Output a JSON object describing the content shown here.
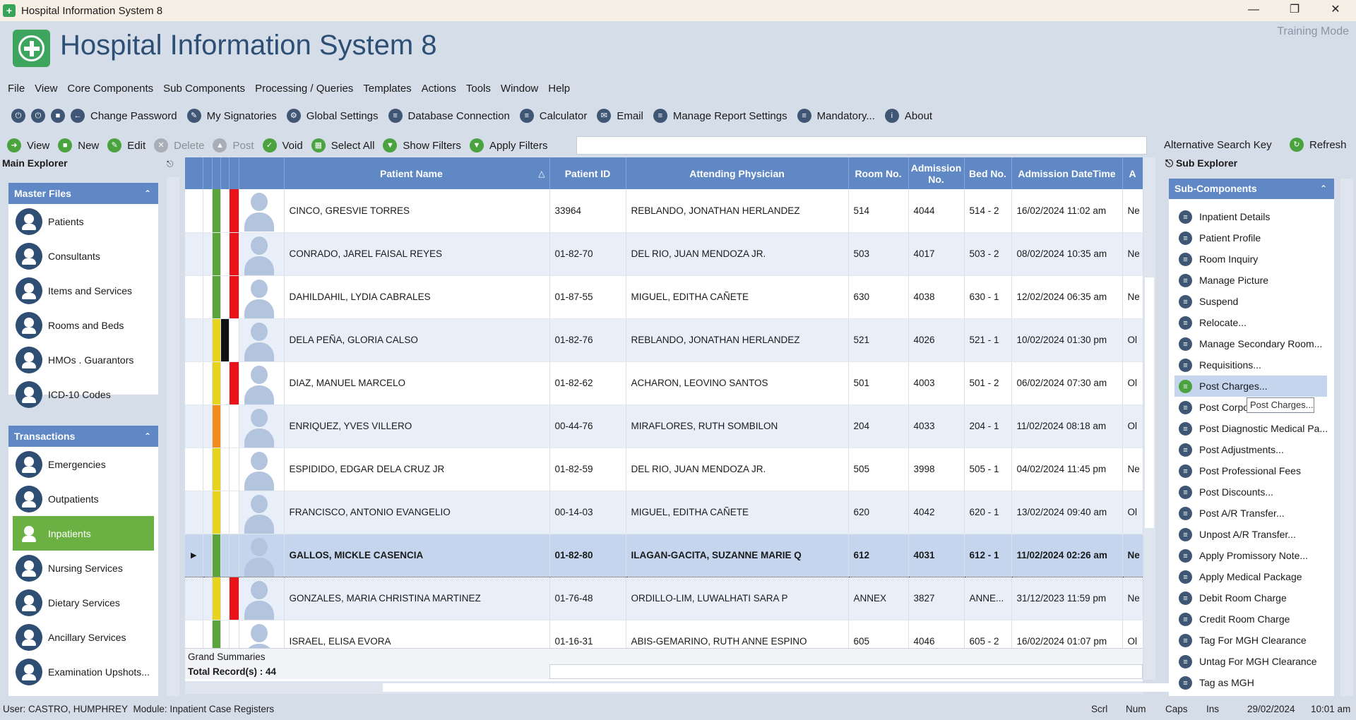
{
  "window": {
    "title": "Hospital Information System 8"
  },
  "banner": {
    "title": "Hospital Information System 8",
    "mode": "Training Mode"
  },
  "menu": [
    "File",
    "View",
    "Core Components",
    "Sub Components",
    "Processing / Queries",
    "Templates",
    "Actions",
    "Tools",
    "Window",
    "Help"
  ],
  "toolbar1": [
    "Change Password",
    "My Signatories",
    "Global Settings",
    "Database Connection",
    "Calculator",
    "Email",
    "Manage Report Settings",
    "Mandatory...",
    "About"
  ],
  "toolbar2": {
    "view": "View",
    "new": "New",
    "edit": "Edit",
    "delete": "Delete",
    "post": "Post",
    "void": "Void",
    "select_all": "Select All",
    "show_filters": "Show Filters",
    "apply_filters": "Apply Filters",
    "search_value": "",
    "alt_search": "Alternative Search Key",
    "refresh": "Refresh"
  },
  "left": {
    "header": "Main Explorer",
    "master_title": "Master Files",
    "master_items": [
      "Patients",
      "Consultants",
      "Items and Services",
      "Rooms and Beds",
      "HMOs . Guarantors",
      "ICD-10 Codes"
    ],
    "trans_title": "Transactions",
    "trans_items": [
      "Emergencies",
      "Outpatients",
      "Inpatients",
      "Nursing Services",
      "Dietary Services",
      "Ancillary Services",
      "Examination Upshots..."
    ]
  },
  "grid": {
    "columns": [
      "Patient Name",
      "Patient ID",
      "Attending Physician",
      "Room No.",
      "Admission No.",
      "Bed No.",
      "Admission DateTime",
      "A"
    ],
    "rows": [
      {
        "name": "CINCO, GRESVIE TORRES",
        "id": "33964",
        "phys": "REBLANDO, JONATHAN HERLANDEZ",
        "room": "514",
        "adm": "4044",
        "bed": "514 - 2",
        "dt": "16/02/2024 11:02 am",
        "x": "Ne",
        "c1": "#5aa43b",
        "c2": "#ffffff",
        "c3": "#e8141a"
      },
      {
        "name": "CONRADO, JAREL FAISAL REYES",
        "id": "01-82-70",
        "phys": "DEL RIO, JUAN MENDOZA JR.",
        "room": "503",
        "adm": "4017",
        "bed": "503 - 2",
        "dt": "08/02/2024 10:35 am",
        "x": "Ne",
        "c1": "#5aa43b",
        "c2": "#ffffff",
        "c3": "#e8141a"
      },
      {
        "name": "DAHILDAHIL, LYDIA CABRALES",
        "id": "01-87-55",
        "phys": "MIGUEL, EDITHA CAÑETE",
        "room": "630",
        "adm": "4038",
        "bed": "630 - 1",
        "dt": "12/02/2024 06:35 am",
        "x": "Ne",
        "c1": "#5aa43b",
        "c2": "#ffffff",
        "c3": "#e8141a"
      },
      {
        "name": "DELA PEÑA, GLORIA CALSO",
        "id": "01-82-76",
        "phys": "REBLANDO, JONATHAN HERLANDEZ",
        "room": "521",
        "adm": "4026",
        "bed": "521 - 1",
        "dt": "10/02/2024 01:30 pm",
        "x": "Ol",
        "c1": "#e6d41d",
        "c2": "#111111",
        "c3": "#ffffff"
      },
      {
        "name": "DIAZ, MANUEL MARCELO",
        "id": "01-82-62",
        "phys": "ACHARON, LEOVINO SANTOS",
        "room": "501",
        "adm": "4003",
        "bed": "501 - 2",
        "dt": "06/02/2024 07:30 am",
        "x": "Ol",
        "c1": "#e6d41d",
        "c2": "#ffffff",
        "c3": "#e8141a"
      },
      {
        "name": "ENRIQUEZ, YVES VILLERO",
        "id": "00-44-76",
        "phys": "MIRAFLORES, RUTH SOMBILON",
        "room": "204",
        "adm": "4033",
        "bed": "204 - 1",
        "dt": "11/02/2024 08:18 am",
        "x": "Ol",
        "c1": "#f28c1c",
        "c2": "#ffffff",
        "c3": "#ffffff"
      },
      {
        "name": "ESPIDIDO, EDGAR DELA CRUZ JR",
        "id": "01-82-59",
        "phys": "DEL RIO, JUAN MENDOZA JR.",
        "room": "505",
        "adm": "3998",
        "bed": "505 - 1",
        "dt": "04/02/2024 11:45 pm",
        "x": "Ne",
        "c1": "#e6d41d",
        "c2": "#ffffff",
        "c3": "#ffffff"
      },
      {
        "name": "FRANCISCO, ANTONIO EVANGELIO",
        "id": "00-14-03",
        "phys": "MIGUEL, EDITHA CAÑETE",
        "room": "620",
        "adm": "4042",
        "bed": "620 - 1",
        "dt": "13/02/2024 09:40 am",
        "x": "Ol",
        "c1": "#e6d41d",
        "c2": "#ffffff",
        "c3": "#ffffff"
      },
      {
        "name": "GALLOS, MICKLE CASENCIA",
        "id": "01-82-80",
        "phys": "ILAGAN-GACITA, SUZANNE MARIE Q",
        "room": "612",
        "adm": "4031",
        "bed": "612 - 1",
        "dt": "11/02/2024 02:26 am",
        "x": "Ne",
        "c1": "#5aa43b",
        "c2": "#c5d5ee",
        "c3": "#c5d5ee"
      },
      {
        "name": "GONZALES, MARIA CHRISTINA MARTINEZ",
        "id": "01-76-48",
        "phys": "ORDILLO-LIM, LUWALHATI SARA P",
        "room": "ANNEX",
        "adm": "3827",
        "bed": "ANNE...",
        "dt": "31/12/2023 11:59 pm",
        "x": "Ne",
        "c1": "#e6d41d",
        "c2": "#ffffff",
        "c3": "#e8141a"
      },
      {
        "name": "ISRAEL, ELISA EVORA",
        "id": "01-16-31",
        "phys": "ABIS-GEMARINO, RUTH ANNE ESPINO",
        "room": "605",
        "adm": "4046",
        "bed": "605 - 2",
        "dt": "16/02/2024 01:07 pm",
        "x": "Ol",
        "c1": "#5aa43b",
        "c2": "#ffffff",
        "c3": "#ffffff"
      }
    ],
    "grand_summaries": "Grand Summaries",
    "total_records": "Total Record(s) : 44"
  },
  "right": {
    "header": "Sub Explorer",
    "group_title": "Sub-Components",
    "items": [
      "Inpatient Details",
      "Patient Profile",
      "Room Inquiry",
      "Manage Picture",
      "Suspend",
      "Relocate...",
      "Manage Secondary Room...",
      "Requisitions...",
      "Post Charges...",
      "Post Corpo...",
      "Post Diagnostic Medical Pa...",
      "Post Adjustments...",
      "Post Professional Fees",
      "Post Discounts...",
      "Post A/R Transfer...",
      "Unpost A/R Transfer...",
      "Apply Promissory Note...",
      "Apply Medical Package",
      "Debit Room Charge",
      "Credit Room Charge",
      "Tag For MGH Clearance",
      "Untag For MGH Clearance",
      "Tag as MGH"
    ],
    "tooltip": "Post Charges..."
  },
  "status": {
    "user": "User: CASTRO, HUMPHREY",
    "module": "Module: Inpatient Case Registers",
    "scrl": "Scrl",
    "num": "Num",
    "caps": "Caps",
    "ins": "Ins",
    "date": "29/02/2024",
    "time": "10:01 am"
  },
  "colors": {
    "accent": "#5f88c4",
    "active_green": "#6ab043",
    "selected_row": "#c5d5ee"
  }
}
